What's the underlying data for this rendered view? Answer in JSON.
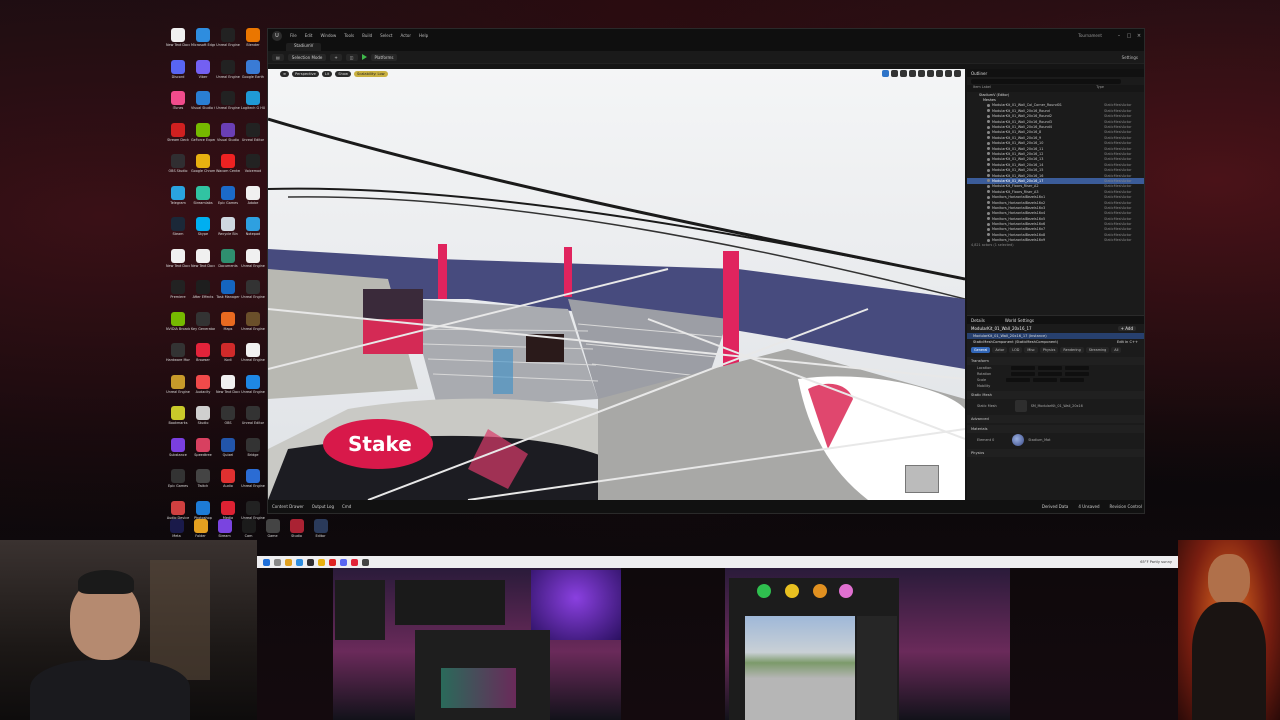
{
  "colors": {
    "accent": "#3b5c99",
    "brand_pink": "#e0245e",
    "play": "#3fb84b",
    "stake_red": "#d8194a"
  },
  "desktop": {
    "icons": [
      {
        "label": "New Text Document",
        "color": "#f0f0f0"
      },
      {
        "label": "Microsoft Edge",
        "color": "#2e8ddf"
      },
      {
        "label": "Unreal Engine",
        "color": "#222"
      },
      {
        "label": "Blender",
        "color": "#ea7600"
      },
      {
        "label": "Discord",
        "color": "#5865f2"
      },
      {
        "label": "Viber",
        "color": "#7360f2"
      },
      {
        "label": "Unreal Engine",
        "color": "#222"
      },
      {
        "label": "Google Earth",
        "color": "#3a7bd5"
      },
      {
        "label": "iTunes",
        "color": "#f24c8c"
      },
      {
        "label": "Visual Studio Code",
        "color": "#2a7ed3"
      },
      {
        "label": "Unreal Engine",
        "color": "#222"
      },
      {
        "label": "Logitech G HUB",
        "color": "#1f9ad6"
      },
      {
        "label": "Stream Deck",
        "color": "#d02020"
      },
      {
        "label": "GeForce Experience",
        "color": "#76b900"
      },
      {
        "label": "Visual Studio",
        "color": "#6a3fb5"
      },
      {
        "label": "Unreal Editor",
        "color": "#222"
      },
      {
        "label": "OBS Studio",
        "color": "#302e31"
      },
      {
        "label": "Google Chrome",
        "color": "#e8b010"
      },
      {
        "label": "Wacom Center",
        "color": "#e22"
      },
      {
        "label": "Voicemod",
        "color": "#222"
      },
      {
        "label": "Telegram",
        "color": "#2aa3e0"
      },
      {
        "label": "Streamlabs",
        "color": "#31c3a2"
      },
      {
        "label": "Epic Games",
        "color": "#1b6ac9"
      },
      {
        "label": "Adobe",
        "color": "#f0f0f0"
      },
      {
        "label": "Steam",
        "color": "#1b2838"
      },
      {
        "label": "Skype",
        "color": "#00aff0"
      },
      {
        "label": "Recycle Bin",
        "color": "#cfd8e0"
      },
      {
        "label": "Notepad",
        "color": "#2ea0e0"
      },
      {
        "label": "New Text Document",
        "color": "#f0f0f0"
      },
      {
        "label": "New Text Document",
        "color": "#f0f0f0"
      },
      {
        "label": "Documents",
        "color": "#2f8f6f"
      },
      {
        "label": "Unreal Engine",
        "color": "#f0f0f0"
      },
      {
        "label": "Premiere",
        "color": "#222"
      },
      {
        "label": "After Effects",
        "color": "#1e1e1e"
      },
      {
        "label": "Task Manager",
        "color": "#1565c0"
      },
      {
        "label": "Unreal Engine",
        "color": "#333"
      },
      {
        "label": "NVIDIA Broadcast",
        "color": "#76b900"
      },
      {
        "label": "Key Generator",
        "color": "#333"
      },
      {
        "label": "Maps",
        "color": "#e96a20"
      },
      {
        "label": "Unreal Engine",
        "color": "#6a4f2a"
      },
      {
        "label": "Hardware Monitor",
        "color": "#333"
      },
      {
        "label": "Browser",
        "color": "#e2233a"
      },
      {
        "label": "Kodi",
        "color": "#d02a2a"
      },
      {
        "label": "Unreal Engine",
        "color": "#f0f0f0"
      },
      {
        "label": "Unreal Engine",
        "color": "#c89a2a"
      },
      {
        "label": "Audacity",
        "color": "#f04a4a"
      },
      {
        "label": "New Text Document",
        "color": "#f0f0f0"
      },
      {
        "label": "Unreal Engine",
        "color": "#1e88e5"
      },
      {
        "label": "Bookmarks",
        "color": "#c9c92a"
      },
      {
        "label": "Studio",
        "color": "#cfcfcf"
      },
      {
        "label": "OBS",
        "color": "#333"
      },
      {
        "label": "Unreal Editor",
        "color": "#333"
      },
      {
        "label": "Substance",
        "color": "#7a3fe0"
      },
      {
        "label": "Speedtree",
        "color": "#d84060"
      },
      {
        "label": "Quixel",
        "color": "#2255aa"
      },
      {
        "label": "Bridge",
        "color": "#333"
      },
      {
        "label": "Epic Games",
        "color": "#333"
      },
      {
        "label": "Twitch",
        "color": "#444"
      },
      {
        "label": "Audio",
        "color": "#e03030"
      },
      {
        "label": "Unreal Engine",
        "color": "#2b6cd4"
      },
      {
        "label": "Audio Device",
        "color": "#d04040"
      },
      {
        "label": "Photoshop",
        "color": "#1d7bd6"
      },
      {
        "label": "Media",
        "color": "#d23"
      },
      {
        "label": "Unreal Engine",
        "color": "#222"
      }
    ],
    "bottom_icons": [
      {
        "label": "Meta",
        "color": "#1a1a4a"
      },
      {
        "label": "Folder",
        "color": "#e4a020"
      },
      {
        "label": "Stream",
        "color": "#7a44e0"
      },
      {
        "label": "Cam",
        "color": "#1b1b1b"
      },
      {
        "label": "Game",
        "color": "#444"
      },
      {
        "label": "Studio",
        "color": "#aa2233"
      },
      {
        "label": "Editor",
        "color": "#2a3a5a"
      }
    ]
  },
  "unreal": {
    "menu": [
      "File",
      "Edit",
      "Window",
      "Tools",
      "Build",
      "Select",
      "Actor",
      "Help"
    ],
    "project_name": "Tournament",
    "level_tab": "StadiumV",
    "toolbar": {
      "mode": "Selection Mode",
      "platforms": "Platforms",
      "settings": "Settings"
    },
    "viewport": {
      "chips": [
        "Perspective",
        "Lit",
        "Show",
        "Scalability: Low"
      ],
      "sign_text": "Stake"
    },
    "bottom_bar": {
      "items": [
        "Content Drawer",
        "Output Log",
        "Cmd"
      ],
      "right": [
        "Derived Data",
        "4 Unsaved",
        "Revision Control"
      ]
    },
    "outliner": {
      "title": "Outliner",
      "col_label": "Item Label",
      "col_type": "Type",
      "level": "StadiumV (Editor)",
      "folder": "Meshes",
      "rows": [
        {
          "label": "ModularKit_01_Wall_Col_Corner_Round01",
          "type": "StaticMeshActor"
        },
        {
          "label": "ModularKit_01_Wall_20x16_Round",
          "type": "StaticMeshActor"
        },
        {
          "label": "ModularKit_01_Wall_20x16_Round2",
          "type": "StaticMeshActor"
        },
        {
          "label": "ModularKit_01_Wall_20x16_Round3",
          "type": "StaticMeshActor"
        },
        {
          "label": "ModularKit_01_Wall_20x16_Round4",
          "type": "StaticMeshActor"
        },
        {
          "label": "ModularKit_01_Wall_20x16_8",
          "type": "StaticMeshActor"
        },
        {
          "label": "ModularKit_01_Wall_20x16_9",
          "type": "StaticMeshActor"
        },
        {
          "label": "ModularKit_01_Wall_20x16_10",
          "type": "StaticMeshActor"
        },
        {
          "label": "ModularKit_01_Wall_20x16_11",
          "type": "StaticMeshActor"
        },
        {
          "label": "ModularKit_01_Wall_20x16_12",
          "type": "StaticMeshActor"
        },
        {
          "label": "ModularKit_01_Wall_20x16_13",
          "type": "StaticMeshActor"
        },
        {
          "label": "ModularKit_01_Wall_20x16_14",
          "type": "StaticMeshActor"
        },
        {
          "label": "ModularKit_01_Wall_20x16_15",
          "type": "StaticMeshActor"
        },
        {
          "label": "ModularKit_01_Wall_20x16_16",
          "type": "StaticMeshActor"
        },
        {
          "label": "ModularKit_01_Wall_20x16_17",
          "type": "StaticMeshActor",
          "selected": true
        },
        {
          "label": "ModularKit_Floors_Riser_A2",
          "type": "StaticMeshActor"
        },
        {
          "label": "ModularKit_Floors_Riser_A3",
          "type": "StaticMeshActor"
        },
        {
          "label": "Monitors_HorizontalBezels16x1",
          "type": "StaticMeshActor"
        },
        {
          "label": "Monitors_HorizontalBezels16x2",
          "type": "StaticMeshActor"
        },
        {
          "label": "Monitors_HorizontalBezels16x3",
          "type": "StaticMeshActor"
        },
        {
          "label": "Monitors_HorizontalBezels16x4",
          "type": "StaticMeshActor"
        },
        {
          "label": "Monitors_HorizontalBezels16x5",
          "type": "StaticMeshActor"
        },
        {
          "label": "Monitors_HorizontalBezels16x6",
          "type": "StaticMeshActor"
        },
        {
          "label": "Monitors_HorizontalBezels16x7",
          "type": "StaticMeshActor"
        },
        {
          "label": "Monitors_HorizontalBezels16x8",
          "type": "StaticMeshActor"
        },
        {
          "label": "Monitors_HorizontalBezels16x9",
          "type": "StaticMeshActor"
        }
      ],
      "count": "4,821 actors (1 selected)"
    },
    "details": {
      "tabs_head": [
        "Details",
        "World Settings"
      ],
      "actor": "ModularKit_01_Wall_20x16_17",
      "add": "+ Add",
      "components": [
        "ModularKit_01_Wall_20x16_17 (Instance)",
        "StaticMeshComponent (StaticMeshComponent)"
      ],
      "edit_in": "Edit in C++",
      "filter_tabs": [
        "General",
        "Actor",
        "LOD",
        "Misc",
        "Physics",
        "Rendering",
        "Streaming",
        "All"
      ],
      "sections": [
        "Transform",
        "Static Mesh",
        "Advanced",
        "Materials",
        "Physics"
      ],
      "props": [
        "Location",
        "Rotation",
        "Scale",
        "Mobility"
      ],
      "static_mesh_label": "Static Mesh",
      "static_mesh_value": "SM_ModularKit_01_Wall_20x16",
      "element_label": "Element 0",
      "element_value": "Stadium_Mat"
    }
  },
  "taskbar": {
    "tray_text": "65°F  Partly sunny"
  }
}
